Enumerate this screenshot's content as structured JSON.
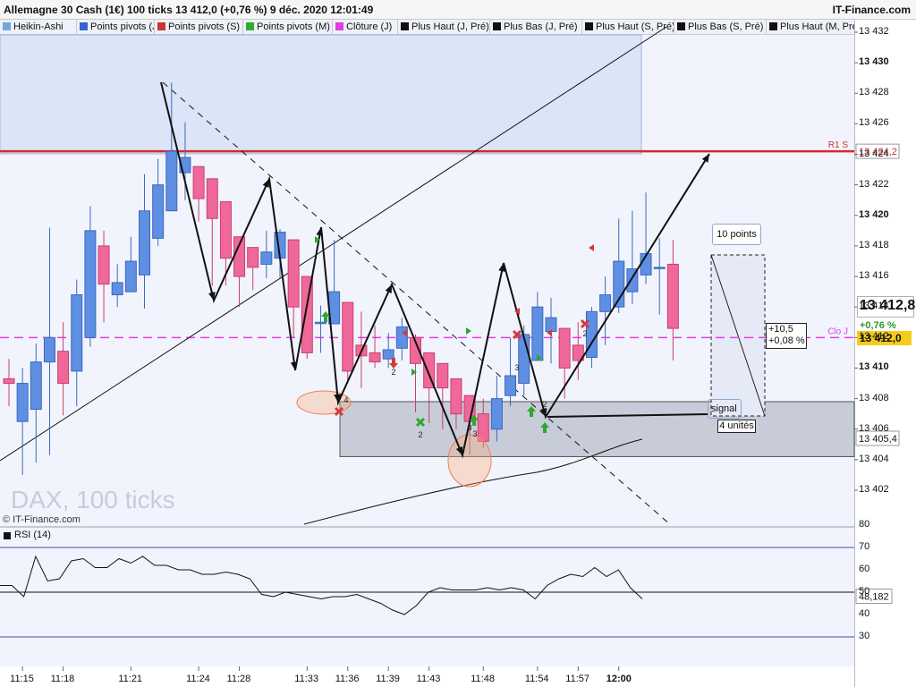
{
  "header": {
    "title": "Allemagne 30 Cash (1€) 100 ticks 13 412,0 (+0,76 %) 9 déc. 2020 12:01:49",
    "source": "IT-Finance.com"
  },
  "tabs": [
    {
      "label": "Heikin-Ashi",
      "color": "#6fa8dc"
    },
    {
      "label": "Points pivots (J)",
      "color": "#3366cc"
    },
    {
      "label": "Points pivots (S)",
      "color": "#cc3333"
    },
    {
      "label": "Points pivots (M)",
      "color": "#33aa33"
    },
    {
      "label": "Clôture (J)",
      "color": "#e040e0"
    },
    {
      "label": "Plus Haut (J, Pré)",
      "color": "#111111"
    },
    {
      "label": "Plus Bas (J, Pré)",
      "color": "#111111"
    },
    {
      "label": "Plus Haut (S, Pré)",
      "color": "#111111"
    },
    {
      "label": "Plus Bas (S, Pré)",
      "color": "#111111"
    },
    {
      "label": "Plus Haut (M, Pré)",
      "color": "#111111"
    }
  ],
  "chart_data": [
    {
      "type": "candlestick",
      "watermark": "DAX, 100 ticks",
      "credit": "© IT-Finance.com",
      "ylim": [
        13400.4,
        13433.2
      ],
      "y_ticks": [
        13402,
        13404,
        13406,
        13408,
        13410,
        13412,
        13414,
        13416,
        13418,
        13420,
        13422,
        13424,
        13426,
        13428,
        13430,
        13432
      ],
      "y_tick_labels": [
        "13 402",
        "13 404",
        "13 406",
        "13 408",
        "13 410",
        "13 412",
        "13 414",
        "13 416",
        "13 418",
        "13 420",
        "13 422",
        "13 424",
        "13 426",
        "13 428",
        "13 430",
        "13 432"
      ],
      "x_tick_labels": [
        "11:15",
        "11:18",
        "11:21",
        "11:24",
        "11:28",
        "11:33",
        "11:36",
        "11:39",
        "11:43",
        "11:48",
        "11:54",
        "11:57",
        "12:00"
      ],
      "x_tick_index": [
        1,
        4,
        9,
        14,
        17,
        22,
        25,
        28,
        31,
        35,
        39,
        42,
        45
      ],
      "candles": [
        {
          "o": 13409.3,
          "c": 13409.0,
          "h": 13410.6,
          "l": 13407.5
        },
        {
          "o": 13406.5,
          "c": 13409.0,
          "h": 13410.0,
          "l": 13403.0
        },
        {
          "o": 13407.3,
          "c": 13410.4,
          "h": 13411.6,
          "l": 13403.8
        },
        {
          "o": 13410.4,
          "c": 13412.0,
          "h": 13419.2,
          "l": 13404.3
        },
        {
          "o": 13411.1,
          "c": 13409.0,
          "h": 13413.0,
          "l": 13406.9
        },
        {
          "o": 13409.8,
          "c": 13414.8,
          "h": 13415.8,
          "l": 13407.5
        },
        {
          "o": 13412.0,
          "c": 13419.0,
          "h": 13420.6,
          "l": 13411.4
        },
        {
          "o": 13418.0,
          "c": 13415.5,
          "h": 13419.0,
          "l": 13413.0
        },
        {
          "o": 13414.8,
          "c": 13415.6,
          "h": 13416.8,
          "l": 13414.0
        },
        {
          "o": 13415.0,
          "c": 13417.0,
          "h": 13418.6,
          "l": 13415.0
        },
        {
          "o": 13416.1,
          "c": 13420.3,
          "h": 13422.7,
          "l": 13413.9
        },
        {
          "o": 13418.5,
          "c": 13422.0,
          "h": 13423.7,
          "l": 13418.0
        },
        {
          "o": 13420.3,
          "c": 13424.2,
          "h": 13428.7,
          "l": 13420.3
        },
        {
          "o": 13422.8,
          "c": 13423.8,
          "h": 13426.1,
          "l": 13421.0
        },
        {
          "o": 13423.2,
          "c": 13421.1,
          "h": 13423.2,
          "l": 13419.6
        },
        {
          "o": 13422.4,
          "c": 13419.8,
          "h": 13422.4,
          "l": 13415.4
        },
        {
          "o": 13420.9,
          "c": 13417.2,
          "h": 13420.9,
          "l": 13415.4
        },
        {
          "o": 13418.6,
          "c": 13416.0,
          "h": 13418.6,
          "l": 13414.0
        },
        {
          "o": 13417.9,
          "c": 13416.6,
          "h": 13417.9,
          "l": 13415.1
        },
        {
          "o": 13416.8,
          "c": 13417.6,
          "h": 13419.0,
          "l": 13415.9
        },
        {
          "o": 13417.2,
          "c": 13418.9,
          "h": 13419.1,
          "l": 13415.9
        },
        {
          "o": 13418.4,
          "c": 13414.0,
          "h": 13418.4,
          "l": 13412.0
        },
        {
          "o": 13416.0,
          "c": 13411.0,
          "h": 13416.0,
          "l": 13410.6
        },
        {
          "o": 13413.0,
          "c": 13413.0,
          "h": 13414.1,
          "l": 13411.0
        },
        {
          "o": 13412.9,
          "c": 13415.0,
          "h": 13418.4,
          "l": 13412.9
        },
        {
          "o": 13414.3,
          "c": 13409.8,
          "h": 13414.3,
          "l": 13409.0
        },
        {
          "o": 13411.5,
          "c": 13410.8,
          "h": 13413.7,
          "l": 13408.7
        },
        {
          "o": 13411.0,
          "c": 13410.4,
          "h": 13412.8,
          "l": 13410.0
        },
        {
          "o": 13410.6,
          "c": 13411.2,
          "h": 13412.3,
          "l": 13410.0
        },
        {
          "o": 13411.3,
          "c": 13412.7,
          "h": 13413.3,
          "l": 13410.5
        },
        {
          "o": 13412.0,
          "c": 13410.3,
          "h": 13412.2,
          "l": 13407.1
        },
        {
          "o": 13411.0,
          "c": 13408.7,
          "h": 13411.0,
          "l": 13406.4
        },
        {
          "o": 13410.3,
          "c": 13408.7,
          "h": 13410.3,
          "l": 13406.0
        },
        {
          "o": 13409.3,
          "c": 13407.0,
          "h": 13409.3,
          "l": 13406.0
        },
        {
          "o": 13408.2,
          "c": 13406.5,
          "h": 13408.2,
          "l": 13404.3
        },
        {
          "o": 13407.0,
          "c": 13405.2,
          "h": 13408.0,
          "l": 13404.8
        },
        {
          "o": 13406.0,
          "c": 13408.0,
          "h": 13409.5,
          "l": 13405.2
        },
        {
          "o": 13408.2,
          "c": 13409.5,
          "h": 13412.0,
          "l": 13407.5
        },
        {
          "o": 13409.0,
          "c": 13412.2,
          "h": 13412.8,
          "l": 13408.2
        },
        {
          "o": 13410.5,
          "c": 13414.0,
          "h": 13415.0,
          "l": 13410.5
        },
        {
          "o": 13412.4,
          "c": 13413.3,
          "h": 13414.6,
          "l": 13410.3
        },
        {
          "o": 13412.6,
          "c": 13410.0,
          "h": 13412.6,
          "l": 13408.0
        },
        {
          "o": 13411.5,
          "c": 13410.5,
          "h": 13413.0,
          "l": 13409.2
        },
        {
          "o": 13410.7,
          "c": 13413.7,
          "h": 13414.0,
          "l": 13410.0
        },
        {
          "o": 13413.7,
          "c": 13414.8,
          "h": 13416.0,
          "l": 13411.5
        },
        {
          "o": 13414.0,
          "c": 13417.0,
          "h": 13419.8,
          "l": 13413.6
        },
        {
          "o": 13415.0,
          "c": 13416.5,
          "h": 13420.3,
          "l": 13414.2
        },
        {
          "o": 13416.1,
          "c": 13417.5,
          "h": 13421.5,
          "l": 13415.5
        },
        {
          "o": 13416.6,
          "c": 13416.6,
          "h": 13418.5,
          "l": 13413.5
        },
        {
          "o": 13416.8,
          "c": 13412.6,
          "h": 13418.4,
          "l": 13410.5
        }
      ],
      "levels": [
        {
          "label": "R1 S",
          "value": 13424.2,
          "tag": "13 424,2",
          "color": "#d42a2a"
        },
        {
          "label": "Clo J",
          "value": 13412.0,
          "tag": "",
          "color": "#e040e0"
        },
        {
          "label": "",
          "value": 13405.4,
          "tag": "13 405,4",
          "color": "#444444"
        }
      ],
      "price_readout": {
        "big": "13 412,8",
        "change": "+0,76 %",
        "last": "13 412,0",
        "last_color": "#f5cc1c"
      },
      "signal_zone": {
        "top": 13407.8,
        "bottom": 13404.2
      },
      "boxes": {
        "points": "10 points",
        "change_value": "+10,5",
        "change_pct": "+0,08 %",
        "signal": "signal",
        "units": "4 unités"
      },
      "wave_labels": [
        "4",
        "2",
        "2",
        "3",
        "3",
        "2",
        "3",
        "2"
      ]
    },
    {
      "type": "line",
      "name": "RSI (14)",
      "ylim": [
        20,
        83
      ],
      "y_ticks": [
        30,
        40,
        50,
        60,
        70,
        80
      ],
      "levels": [
        30,
        50,
        70
      ],
      "last": "48,182",
      "values": [
        53,
        53,
        48,
        66,
        55,
        56,
        64,
        65,
        61,
        61,
        65,
        63,
        66,
        62,
        62,
        60,
        60,
        58,
        58,
        59,
        58,
        56,
        49,
        48,
        50,
        49,
        48,
        47,
        48,
        48,
        49,
        47,
        45,
        42,
        40,
        44,
        50,
        52,
        51,
        51,
        51,
        52,
        51,
        52,
        51,
        47,
        53,
        56,
        58,
        57,
        61,
        57,
        60,
        52,
        47
      ]
    }
  ]
}
